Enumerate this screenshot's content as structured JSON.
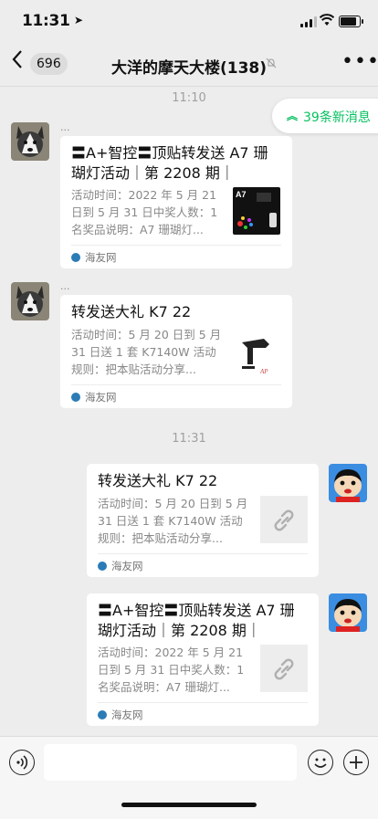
{
  "status": {
    "time": "11:31",
    "location_icon": "location-arrow-icon",
    "battery_level": 0.85
  },
  "nav": {
    "back_icon": "chevron-left-icon",
    "unread_count": "696",
    "title": "大洋的摩天大楼(138)",
    "mute_icon": "bell-slash-icon",
    "more_label": "•••"
  },
  "new_messages": {
    "label": "39条新消息",
    "icon": "double-chevron-up-icon"
  },
  "timestamps": [
    "11:10",
    "11:31"
  ],
  "messages": [
    {
      "sender_avatar": "husky-dog-avatar",
      "sender_name": "...",
      "title": "〓A+智控〓顶贴转发送 A7 珊瑚灯活动｜第 2208 期｜",
      "desc": "活动时间：2022 年 5 月 21 日到 5 月 31 日中奖人数：1 名奖品说明：A7 珊瑚灯...",
      "thumb": "A7",
      "source": "海友网"
    },
    {
      "sender_avatar": "husky-dog-avatar",
      "sender_name": "...",
      "title": "转发送大礼 K7 22",
      "desc": "活动时间：5 月 20 日到 5 月 31 日送 1 套 K7140W 活动规则：把本贴活动分享...",
      "thumb": "K7 lamp",
      "source": "海友网"
    },
    {
      "sender_avatar": "cartoon-boy-avatar",
      "title": "转发送大礼 K7 22",
      "desc": "活动时间：5 月 20 日到 5 月 31 日送 1 套 K7140W 活动规则：把本贴活动分享...",
      "thumb": "link-icon",
      "source": "海友网"
    },
    {
      "sender_avatar": "cartoon-boy-avatar",
      "title": "〓A+智控〓顶贴转发送 A7 珊瑚灯活动｜第 2208 期｜",
      "desc": "活动时间：2022 年 5 月 21 日到 5 月 31 日中奖人数：1 名奖品说明：A7 珊瑚灯...",
      "thumb": "link-icon",
      "source": "海友网"
    }
  ],
  "input": {
    "voice_icon": "voice-icon",
    "emoji_icon": "emoji-icon",
    "plus_icon": "plus-icon"
  },
  "colors": {
    "accent": "#07c160",
    "background": "#ededed",
    "card": "#ffffff"
  }
}
